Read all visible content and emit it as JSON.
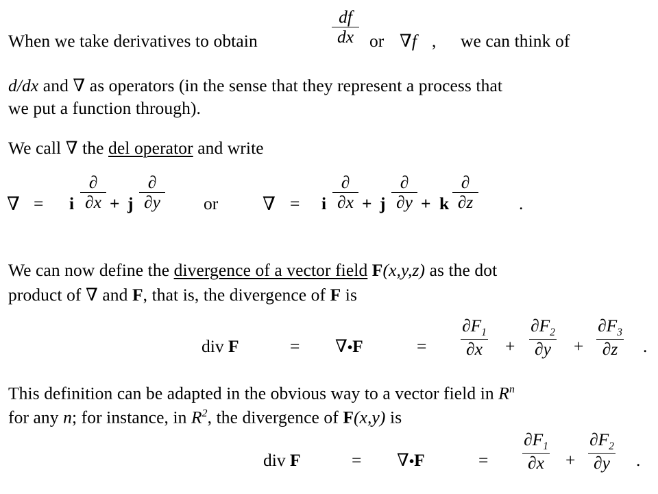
{
  "document": {
    "kind": "lecture-slide",
    "topic": "Del operator and divergence of a vector field",
    "background_color": "#ffffff",
    "text_color": "#000000"
  },
  "paragraph1": {
    "line1_part1": "When we take derivatives to obtain",
    "fraction1": {
      "numerator": "df",
      "denominator": "dx"
    },
    "or1": "or",
    "nabla_f": "∇f",
    "comma": ",",
    "line1_part2": "we can think of",
    "line2_lead_italic": "d/dx",
    "line2_rest": "and ∇ as operators (in the sense that they represent a process that",
    "line3": "we put a function through)."
  },
  "paragraph2": {
    "before": "We call ∇ the",
    "underlined": "del operator",
    "after": "and write"
  },
  "equation_del_2d": {
    "nabla": "∇",
    "equals": "=",
    "i": "i",
    "frac_x": {
      "numerator": "∂",
      "denominator": "∂x"
    },
    "plus": "+",
    "j": "j",
    "frac_y": {
      "numerator": "∂",
      "denominator": "∂y"
    },
    "or": "or"
  },
  "equation_del_3d": {
    "nabla": "∇",
    "equals": "=",
    "i": "i",
    "frac_x": {
      "numerator": "∂",
      "denominator": "∂x"
    },
    "plus1": "+",
    "j": "j",
    "frac_y": {
      "numerator": "∂",
      "denominator": "∂y"
    },
    "plus2": "+",
    "k": "k",
    "frac_z": {
      "numerator": "∂",
      "denominator": "∂z"
    },
    "period": "."
  },
  "paragraph3": {
    "before": "We can now define the",
    "underlined": "divergence of a vector field",
    "bold_F": "F",
    "F_args": "(x,y,z)",
    "after": "as the dot",
    "line2_a": "product of ∇ and",
    "line2_bold_F": "F",
    "line2_b": ", that is, the divergence of",
    "line2_bold_F2": "F",
    "line2_c": "is"
  },
  "equation_div_3d": {
    "div": "div",
    "boldF": "F",
    "equals1": "=",
    "nabla": "∇",
    "dot": "•",
    "boldF2": "F",
    "equals2": "=",
    "term1": {
      "numerator": "∂F",
      "numerator_sub": "1",
      "denominator": "∂x"
    },
    "plus1": "+",
    "term2": {
      "numerator": "∂F",
      "numerator_sub": "2",
      "denominator": "∂y"
    },
    "plus2": "+",
    "term3": {
      "numerator": "∂F",
      "numerator_sub": "3",
      "denominator": "∂z"
    },
    "period": "."
  },
  "paragraph4": {
    "line1": "This definition can be adapted in the obvious way to a vector field in",
    "line1_R": "R",
    "line1_R_sup": "n",
    "line2_a": "for any",
    "line2_n": "n",
    "line2_b": "; for instance, in",
    "line2_R": "R",
    "line2_R_sup": "2",
    "line2_c": ", the divergence of",
    "line2_boldF": "F",
    "line2_args": "(x,y)",
    "line2_d": "is"
  },
  "equation_div_2d": {
    "div": "div",
    "boldF": "F",
    "equals1": "=",
    "nabla": "∇",
    "dot": "•",
    "boldF2": "F",
    "equals2": "=",
    "term1": {
      "numerator": "∂F",
      "numerator_sub": "1",
      "denominator": "∂x"
    },
    "plus1": "+",
    "term2": {
      "numerator": "∂F",
      "numerator_sub": "2",
      "denominator": "∂y"
    },
    "period": "."
  }
}
